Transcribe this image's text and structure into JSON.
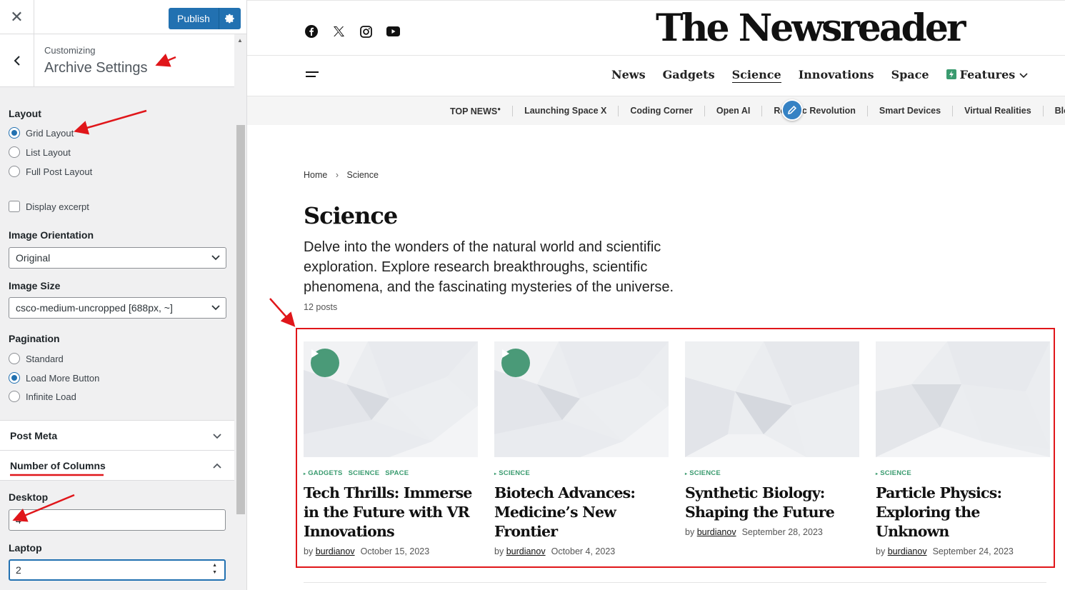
{
  "customizer": {
    "publish_label": "Publish",
    "section": {
      "context": "Customizing",
      "title": "Archive Settings"
    },
    "layout": {
      "label": "Layout",
      "options": [
        "Grid Layout",
        "List Layout",
        "Full Post Layout"
      ],
      "selected": "Grid Layout"
    },
    "display_excerpt": {
      "label": "Display excerpt",
      "checked": false
    },
    "image_orientation": {
      "label": "Image Orientation",
      "value": "Original"
    },
    "image_size": {
      "label": "Image Size",
      "value": "csco-medium-uncropped [688px, ~]"
    },
    "pagination": {
      "label": "Pagination",
      "options": [
        "Standard",
        "Load More Button",
        "Infinite Load"
      ],
      "selected": "Load More Button"
    },
    "post_meta": {
      "label": "Post Meta"
    },
    "number_of_columns": {
      "label": "Number of Columns",
      "desktop_label": "Desktop",
      "desktop_value": "4",
      "laptop_label": "Laptop",
      "laptop_value": "2"
    }
  },
  "site": {
    "logo": "The Newsreader",
    "social_icons": [
      "facebook-icon",
      "x-icon",
      "instagram-icon",
      "youtube-icon"
    ],
    "nav": [
      "News",
      "Gadgets",
      "Science",
      "Innovations",
      "Space",
      "Features"
    ],
    "active_nav": "Science",
    "topics": [
      "TOP NEWS",
      "Launching Space X",
      "Coding Corner",
      "Open AI",
      "Robotic Revolution",
      "Smart Devices",
      "Virtual Realities",
      "Blockchain"
    ],
    "breadcrumb": {
      "home": "Home",
      "current": "Science"
    },
    "page_title": "Science",
    "description": "Delve into the wonders of the natural world and scientific exploration. Explore research breakthroughs, scientific phenomena, and the fascinating mysteries of the universe.",
    "post_count": "12 posts",
    "posts": [
      {
        "categories": [
          "GADGETS",
          "SCIENCE",
          "SPACE"
        ],
        "title": "Tech Thrills: Immerse in the Future with VR Innovations",
        "by": "by",
        "author": "burdianov",
        "date": "October 15, 2023",
        "video": true
      },
      {
        "categories": [
          "SCIENCE"
        ],
        "title": "Biotech Advances: Medicine’s New Frontier",
        "by": "by",
        "author": "burdianov",
        "date": "October 4, 2023",
        "video": true
      },
      {
        "categories": [
          "SCIENCE"
        ],
        "title": "Synthetic Biology: Shaping the Future",
        "by": "by",
        "author": "burdianov",
        "date": "September 28, 2023",
        "video": false
      },
      {
        "categories": [
          "SCIENCE"
        ],
        "title": "Particle Physics: Exploring the Unknown",
        "by": "by",
        "author": "burdianov",
        "date": "September 24, 2023",
        "video": false
      }
    ]
  },
  "colors": {
    "accent": "#2271b1",
    "category_green": "#3a9b6f",
    "annotation_red": "#e0161a"
  }
}
